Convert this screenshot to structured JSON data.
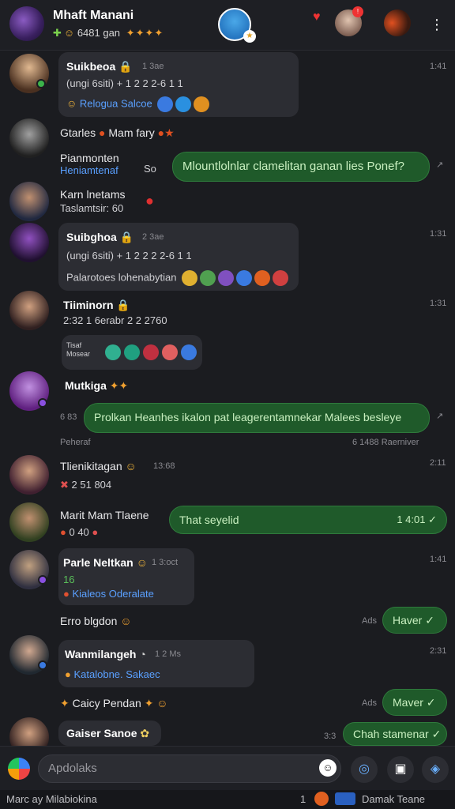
{
  "header": {
    "title": "Mhaft Manani",
    "subtitle": "6481 gan",
    "subtitle_stars": "✦✦✦✦",
    "more_label": "⋮"
  },
  "messages": [
    {
      "name": "Suikbeoa",
      "tag": "🔒",
      "meta": "1 3ae",
      "line2": "(ungi 6siti) + 1 2 2 2-6 1 1",
      "line3": "Relogua Salcoe",
      "time": "1:41"
    },
    {
      "name": "Gtarles",
      "name2": "Mam fary",
      "time": ""
    },
    {
      "name": "Pianmonten",
      "name_sub": "Heniamtenaf",
      "time_left": "So",
      "text": "Mlountlolnlar clamelitan ganan lies Ponef?"
    },
    {
      "name": "Karn lnetams",
      "sub": "Taslamtsir: 60",
      "time": ""
    },
    {
      "name": "Suibghoa",
      "tag": "🔒",
      "meta": "2 3ae",
      "line2": "(ungi 6siti) + 1 2 2 2 2-6 1 1",
      "line3": "Palarotoes lohenabytian",
      "time": "1:31"
    },
    {
      "name": "Tiiminorn",
      "tag": "🔒",
      "line2": "2:32 1 6erabr 2 2 2760",
      "time": "1:31"
    },
    {
      "sticker_label": "Tisaf Mosear",
      "time": ""
    },
    {
      "name": "Mutkiga",
      "tag": "✦✦",
      "time": ""
    },
    {
      "time_left": "6 83",
      "text": "Prolkan Heanhes ikalon pat leagerentamnekar Malees besleye"
    },
    {
      "left": "Peheraf",
      "right": "6 1488 Raerniver"
    },
    {
      "name": "Tlienikitagan",
      "meta": "13:68",
      "line2": "2 51 804",
      "time": "2:11"
    },
    {
      "name": "Marit Mam Tlaene",
      "line2": "0 40",
      "text": "That seyelid",
      "text_time": "1 4:01 ✓"
    },
    {
      "name": "Parle Neltkan",
      "meta": "1 3:oct",
      "line2": "16",
      "line3": "Kialeos Oderalate",
      "time": "1:41"
    },
    {
      "name": "Erro blgdon",
      "time_left": "Ads",
      "text": "Haver ✓"
    },
    {
      "name": "Wanmilangeh",
      "meta": "1 2 Ms",
      "line2": "Katalobne. Sakaec",
      "time": "2:31"
    },
    {
      "name": "Caicy Pendan",
      "time_left": "Ads",
      "text": "Maver ✓"
    },
    {
      "name": "Gaiser Sanoe",
      "time_left": "3:3",
      "text": "Chah stamenar ✓"
    }
  ],
  "composer": {
    "placeholder": "Apdolaks"
  },
  "footer": {
    "left": "Marc ay Milabiokina",
    "right_num": "1",
    "right_text": "Damak Teane"
  },
  "colors": {
    "background": "#1b1c20",
    "incoming_bubble": "#2c2d33",
    "outgoing_bubble": "#1f5a2a",
    "accent_blue": "#5aa0ff",
    "online_green": "#3cb34a"
  },
  "icons": [
    "search-icon",
    "notification-icon",
    "more-icon",
    "emoji-icon",
    "attach-icon",
    "camera-icon",
    "send-icon"
  ]
}
